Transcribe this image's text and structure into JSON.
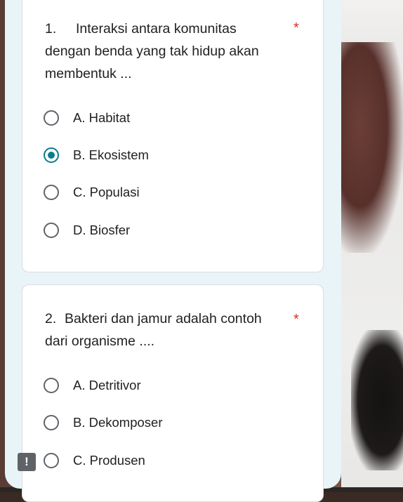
{
  "questions": [
    {
      "number": "1.",
      "text": "Interaksi antara komunitas dengan benda yang tak hidup akan membentuk ...",
      "required": "*",
      "options": [
        "A. Habitat",
        "B. Ekosistem",
        "C. Populasi",
        "D. Biosfer"
      ],
      "selected": "B. Ekosistem"
    },
    {
      "number": "2.",
      "text": "Bakteri dan jamur adalah contoh dari organisme ....",
      "required": "*",
      "options": [
        "A. Detritivor",
        "B. Dekomposer",
        "C. Produsen"
      ],
      "selected": null
    }
  ],
  "alert_badge": "!",
  "colors": {
    "accent": "#0b7c8c",
    "required": "#d93025",
    "form_background": "#e8f4f8"
  }
}
